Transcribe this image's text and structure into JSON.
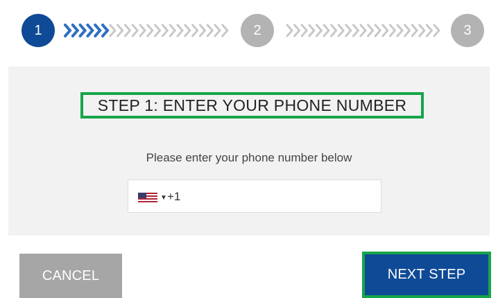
{
  "stepper": {
    "steps": [
      {
        "number": "1",
        "state": "active"
      },
      {
        "number": "2",
        "state": "inactive"
      },
      {
        "number": "3",
        "state": "inactive"
      }
    ],
    "colors": {
      "active": "#0f4a96",
      "inactive": "#b3b3b3",
      "progress_chevron": "#2f6fc4",
      "pending_chevron": "#c8c8c8"
    }
  },
  "card": {
    "title": "STEP 1: ENTER YOUR PHONE NUMBER",
    "instructions": "Please enter your phone number below",
    "phone_input": {
      "country_icon": "us-flag-icon",
      "dial_code": "+1",
      "value": ""
    }
  },
  "actions": {
    "cancel_label": "CANCEL",
    "next_label": "NEXT STEP"
  },
  "highlight_color": "#17a54a"
}
